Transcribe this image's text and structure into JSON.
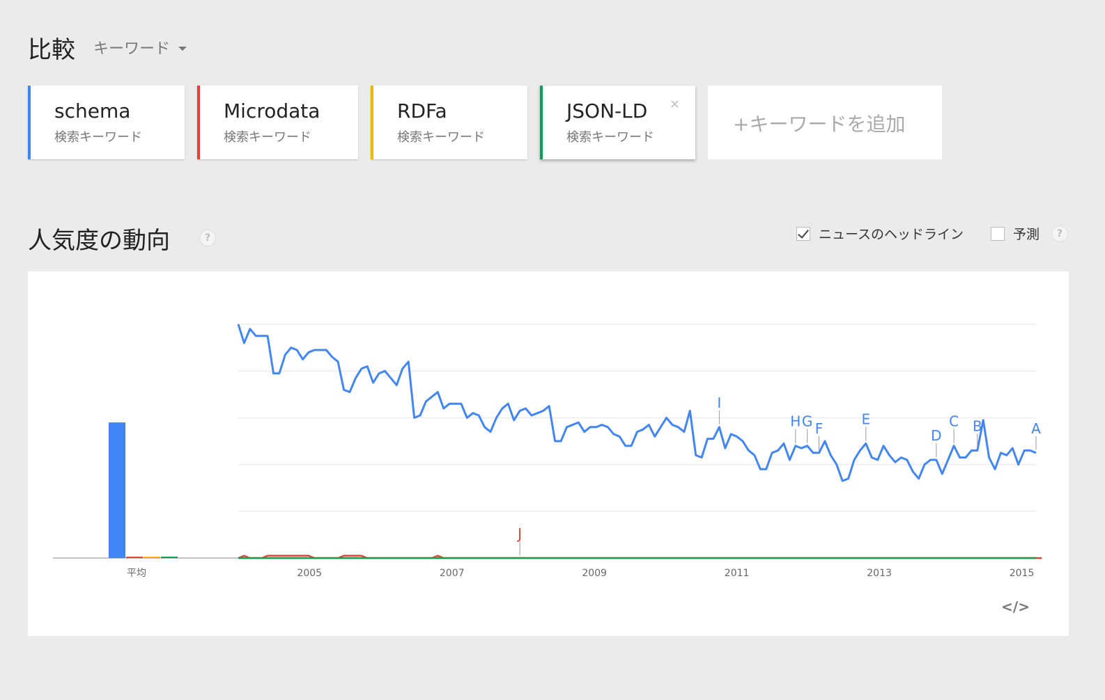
{
  "header": {
    "title": "比較",
    "dropdown_label": "キーワード"
  },
  "terms": [
    {
      "term": "schema",
      "type": "検索キーワード",
      "color": "#4285f4"
    },
    {
      "term": "Microdata",
      "type": "検索キーワード",
      "color": "#db4437"
    },
    {
      "term": "RDFa",
      "type": "検索キーワード",
      "color": "#f4b400"
    },
    {
      "term": "JSON-LD",
      "type": "検索キーワード",
      "color": "#0f9d58",
      "close_label": "×"
    }
  ],
  "add_keyword_label": "+キーワードを追加",
  "trend": {
    "title": "人気度の動向",
    "help": "?",
    "news_label": "ニュースのヘッドライン",
    "news_checked": true,
    "forecast_label": "予測",
    "forecast_checked": false
  },
  "embed_label": "</>",
  "chart_data": {
    "type": "line",
    "avg_label": "平均",
    "averages": [
      {
        "name": "schema",
        "value": 58
      },
      {
        "name": "Microdata",
        "value": 0.6
      },
      {
        "name": "RDFa",
        "value": 0.6
      },
      {
        "name": "JSON-LD",
        "value": 0.6
      }
    ],
    "x_ticks": [
      "2005",
      "2007",
      "2009",
      "2011",
      "2013",
      "2015"
    ],
    "x_start": 2004.0,
    "x_end": 2015.2,
    "ylim": [
      0,
      100
    ],
    "y_gridlines": [
      20,
      40,
      60,
      80,
      100
    ],
    "series": [
      {
        "name": "schema",
        "color": "#4285f4",
        "values": [
          100,
          92,
          98,
          95,
          95,
          95,
          79,
          79,
          87,
          90,
          89,
          85,
          88,
          89,
          89,
          89,
          86,
          84,
          72,
          71,
          77,
          81,
          82,
          75,
          79,
          80,
          77,
          74,
          81,
          84,
          60,
          61,
          67,
          69,
          71,
          64,
          66,
          66,
          66,
          60,
          62,
          61,
          56,
          54,
          60,
          64,
          66,
          59,
          63,
          64,
          61,
          62,
          63,
          65,
          50,
          50,
          56,
          57,
          58,
          54,
          56,
          56,
          57,
          56,
          53,
          52,
          48,
          48,
          54,
          55,
          57,
          52,
          56,
          60,
          57,
          56,
          54,
          63,
          44,
          43,
          51,
          51,
          56,
          47,
          53,
          52,
          50,
          46,
          44,
          38,
          38,
          45,
          46,
          49,
          42,
          48,
          47,
          48,
          45,
          45,
          50,
          44,
          40,
          33,
          34,
          42,
          46,
          49,
          43,
          42,
          48,
          44,
          41,
          43,
          42,
          37,
          34,
          40,
          42,
          42,
          36,
          42,
          48,
          43,
          43,
          46,
          46,
          59,
          43,
          38,
          45,
          44,
          47,
          40,
          46,
          46,
          45
        ],
        "annotations": [
          {
            "letter": "I",
            "x_index": 82
          },
          {
            "letter": "H",
            "x_index": 95
          },
          {
            "letter": "G",
            "x_index": 97
          },
          {
            "letter": "F",
            "x_index": 99
          },
          {
            "letter": "E",
            "x_index": 107
          },
          {
            "letter": "D",
            "x_index": 119
          },
          {
            "letter": "C",
            "x_index": 122
          },
          {
            "letter": "B",
            "x_index": 126
          },
          {
            "letter": "A",
            "x_index": 136
          }
        ]
      },
      {
        "name": "Microdata",
        "color": "#db4437",
        "values": [
          0,
          1,
          0,
          0,
          0,
          1,
          1,
          1,
          1,
          1,
          1,
          1,
          1,
          0,
          0,
          0,
          0,
          0,
          1,
          1,
          1,
          1,
          0,
          0,
          0,
          0,
          0,
          0,
          0,
          0,
          0,
          0,
          0,
          0,
          1,
          0,
          0,
          0,
          0,
          0,
          0,
          0,
          0,
          0,
          0,
          0,
          0,
          0,
          0,
          0,
          0,
          0,
          0,
          0,
          0,
          0,
          0,
          0,
          0,
          0,
          0,
          0,
          0,
          0,
          0,
          0,
          0,
          0,
          0,
          0,
          0,
          0,
          0,
          0,
          0,
          0,
          0,
          0,
          0,
          0,
          0,
          0,
          0,
          0,
          0,
          0,
          0,
          0,
          0,
          0,
          0,
          0,
          0,
          0,
          0,
          0,
          0,
          0,
          0,
          0,
          0,
          0,
          0,
          0,
          0,
          0,
          0,
          0,
          0,
          0,
          0,
          0,
          0,
          0,
          0,
          0,
          0,
          0,
          0,
          0,
          0,
          0,
          0,
          0,
          0,
          0,
          0,
          0,
          0,
          0,
          0,
          0,
          0,
          0,
          0,
          0,
          0,
          0
        ],
        "annotations": [
          {
            "letter": "J",
            "x_index": 48
          }
        ]
      },
      {
        "name": "RDFa",
        "color": "#f4b400",
        "values": [
          0
        ]
      },
      {
        "name": "JSON-LD",
        "color": "#0f9d58",
        "values": [
          0
        ]
      }
    ]
  }
}
